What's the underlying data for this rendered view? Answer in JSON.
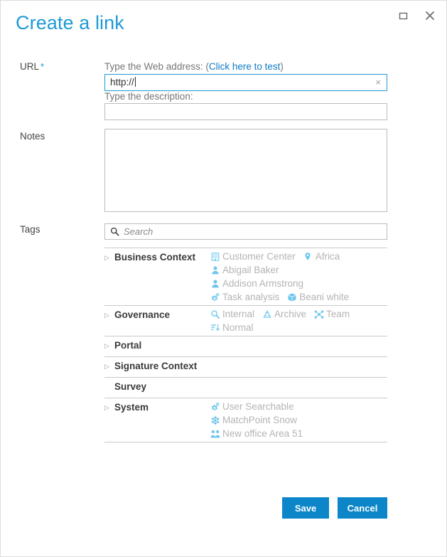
{
  "window": {
    "title": "Create a link",
    "restore_icon": "restore-window-icon",
    "close_icon": "close-icon"
  },
  "form": {
    "url": {
      "label": "URL",
      "required_marker": "*",
      "address_hint_prefix": "Type the Web address: ",
      "address_hint_link": "Click here to test",
      "paren_open": "(",
      "paren_close": ")",
      "value": "http://",
      "clear_icon": "×",
      "description_hint": "Type the description:",
      "description_value": "",
      "description_placeholder": ""
    },
    "notes": {
      "label": "Notes",
      "value": ""
    },
    "tags": {
      "label": "Tags",
      "search_placeholder": "Search",
      "search_value": "",
      "search_icon": "search-icon"
    }
  },
  "tag_sections": [
    {
      "name": "Business Context",
      "expandable": true,
      "arrow": "▷",
      "lines": [
        [
          {
            "label": "Customer Center",
            "icon": "building-icon"
          },
          {
            "label": "Africa",
            "icon": "map-pin-icon"
          }
        ],
        [
          {
            "label": "Abigail Baker",
            "icon": "person-icon"
          }
        ],
        [
          {
            "label": "Addison Armstrong",
            "icon": "person-icon"
          }
        ],
        [
          {
            "label": "Task analysis",
            "icon": "gear-icon"
          },
          {
            "label": "Beani white",
            "icon": "box-icon"
          }
        ]
      ]
    },
    {
      "name": "Governance",
      "expandable": true,
      "arrow": "▷",
      "lines": [
        [
          {
            "label": "Internal",
            "icon": "magnifier-icon"
          },
          {
            "label": "Archive",
            "icon": "recycle-icon"
          },
          {
            "label": "Team",
            "icon": "network-icon"
          }
        ],
        [
          {
            "label": "Normal",
            "icon": "sort-descending-icon"
          }
        ]
      ]
    },
    {
      "name": "Portal",
      "expandable": true,
      "arrow": "▷",
      "lines": []
    },
    {
      "name": "Signature Context",
      "expandable": true,
      "arrow": "▷",
      "lines": []
    },
    {
      "name": "Survey",
      "expandable": false,
      "arrow": "",
      "lines": []
    },
    {
      "name": "System",
      "expandable": true,
      "arrow": "▷",
      "lines": [
        [
          {
            "label": "User Searchable",
            "icon": "gear-icon"
          }
        ],
        [
          {
            "label": "MatchPoint Snow",
            "icon": "snowflake-icon"
          }
        ],
        [
          {
            "label": "New office Area 51",
            "icon": "people-group-icon"
          }
        ]
      ]
    }
  ],
  "footer": {
    "save_label": "Save",
    "cancel_label": "Cancel"
  },
  "colors": {
    "accent": "#1f9ad6",
    "button": "#0c86c9",
    "link": "#0f7bc4",
    "tag_text": "#b4b4b4",
    "icon_blue": "#6ec6ee",
    "label_text": "#444444",
    "hint_text": "#767676"
  }
}
